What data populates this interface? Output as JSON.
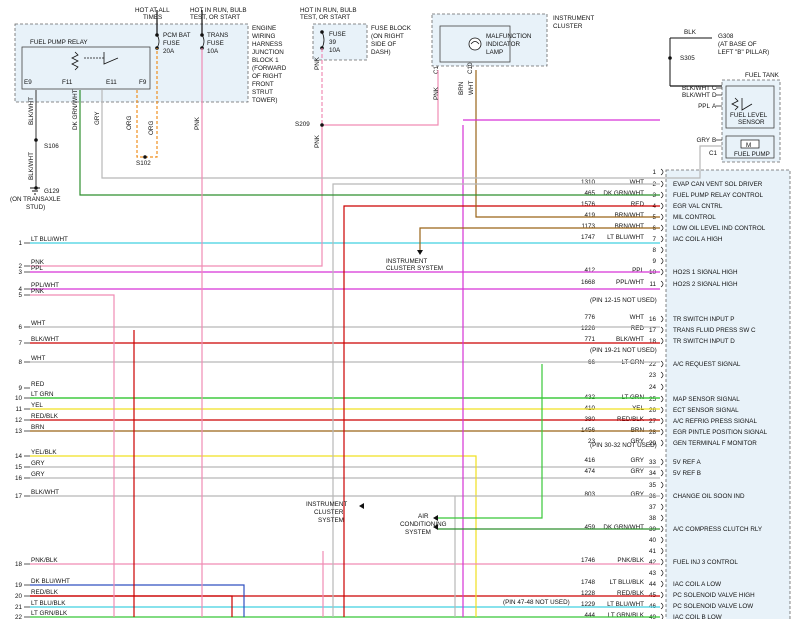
{
  "top_labels": {
    "hot_all": "HOT AT ALL\nTIMES",
    "hot_run_bulb_start": "HOT IN RUN, BULB\nTEST, OR START",
    "hot_run_bulb_start2": "HOT IN RUN, BULB\nTEST, OR START",
    "engine_wiring": "ENGINE\nWIRING\nHARNESS\nJUNCTION\nBLOCK 1\n(FORWARD\nOF RIGHT\nFRONT\nSTRUT\nTOWER)",
    "fuse_block": "FUSE BLOCK\n(ON RIGHT\nSIDE OF\nDASH)",
    "instrument_cluster": "INSTRUMENT\nCLUSTER",
    "g308_note": "(AT BASE OF\nLEFT \"B\" PILLAR)",
    "fuel_tank": "FUEL TANK"
  },
  "components": {
    "fuel_pump_relay": "FUEL PUMP RELAY",
    "pcm_bat_fuse": "PCM BAT\nFUSE\n20A",
    "trans_fuse": "TRANS\nFUSE\n10A",
    "fuse_39": "FUSE\n39\n10A",
    "mil_lamp": "MALFUNCTION\nINDICATOR\nLAMP",
    "fuel_level_sensor": "FUEL LEVEL\nSENSOR",
    "fuel_pump": "FUEL PUMP",
    "g308": "G308",
    "g129": "G129",
    "g129_note": "(ON TRANSAXLE\nSTUD)"
  },
  "pins": {
    "e9": "E9",
    "f11": "F11",
    "e11": "E11",
    "f9": "F9",
    "c1a": "C1",
    "c1b": "C1",
    "c10": "C10",
    "c1_tank": "C1"
  },
  "splices": {
    "s106": "S106",
    "s102": "S102",
    "s209": "S209",
    "s305": "S305"
  },
  "relay_wires": {
    "blk_wht": "BLK/WHT",
    "dk_grn_wht": "DK GRN/WHT",
    "gry": "GRY",
    "org": "ORG",
    "org2": "ORG",
    "pnk": "PNK",
    "blk_wht2": "BLK/WHT",
    "pnk2": "PNK",
    "pnk3": "PNK",
    "pnk4": "PNK",
    "brn": "BRN",
    "wht": "WHT",
    "blk": "BLK"
  },
  "tank_wires": [
    {
      "color": "BLK/WHT",
      "pin": "C"
    },
    {
      "color": "BLK/WHT",
      "pin": "D"
    },
    {
      "color": "PPL",
      "pin": "A"
    },
    {
      "color": "GRY",
      "pin": "B"
    }
  ],
  "left_connector": [
    {
      "num": "1",
      "color": "LT BLU/WHT"
    },
    {
      "num": "2",
      "color": "PNK"
    },
    {
      "num": "3",
      "color": "PPL"
    },
    {
      "num": "4",
      "color": "PPL/WHT"
    },
    {
      "num": "5",
      "color": "PNK"
    },
    {
      "num": "6",
      "color": "WHT"
    },
    {
      "num": "7",
      "color": "BLK/WHT"
    },
    {
      "num": "8",
      "color": "WHT"
    },
    {
      "num": "9",
      "color": "RED"
    },
    {
      "num": "10",
      "color": "LT GRN"
    },
    {
      "num": "11",
      "color": "YEL"
    },
    {
      "num": "12",
      "color": "RED/BLK"
    },
    {
      "num": "13",
      "color": "BRN"
    },
    {
      "num": "14",
      "color": "YEL/BLK"
    },
    {
      "num": "15",
      "color": "GRY"
    },
    {
      "num": "16",
      "color": "GRY"
    },
    {
      "num": "17",
      "color": "BLK/WHT"
    },
    {
      "num": "18",
      "color": "PNK/BLK"
    },
    {
      "num": "19",
      "color": "DK BLU/WHT"
    },
    {
      "num": "20",
      "color": "RED/BLK"
    },
    {
      "num": "21",
      "color": "LT BLU/BLK"
    },
    {
      "num": "22",
      "color": "LT GRN/BLK"
    }
  ],
  "pcm_pins": [
    {
      "pin": "1",
      "circuit": "",
      "wire": "",
      "func": ""
    },
    {
      "pin": "2",
      "circuit": "1310",
      "wire": "WHT",
      "func": "EVAP CAN VENT SOL DRIVER"
    },
    {
      "pin": "3",
      "circuit": "465",
      "wire": "DK GRN/WHT",
      "func": "FUEL PUMP RELAY CONTROL"
    },
    {
      "pin": "4",
      "circuit": "1576",
      "wire": "RED",
      "func": "EGR VAL CNTRL"
    },
    {
      "pin": "5",
      "circuit": "419",
      "wire": "BRN/WHT",
      "func": "MIL CONTROL"
    },
    {
      "pin": "6",
      "circuit": "1173",
      "wire": "BRN/WHT",
      "func": "LOW OIL LEVEL IND CONTROL"
    },
    {
      "pin": "7",
      "circuit": "1747",
      "wire": "LT BLU/WHT",
      "func": "IAC COIL A HIGH"
    },
    {
      "pin": "8",
      "circuit": "",
      "wire": "",
      "func": ""
    },
    {
      "pin": "9",
      "circuit": "",
      "wire": "",
      "func": ""
    },
    {
      "pin": "10",
      "circuit": "412",
      "wire": "PPL",
      "func": "HO2S 1 SIGNAL HIGH"
    },
    {
      "pin": "11",
      "circuit": "1668",
      "wire": "PPL/WHT",
      "func": "HO2S 2 SIGNAL HIGH"
    },
    {
      "pin": "16",
      "circuit": "776",
      "wire": "WHT",
      "func": "TR SWITCH INPUT P"
    },
    {
      "pin": "17",
      "circuit": "1226",
      "wire": "RED",
      "func": "TRANS FLUID PRESS SW C"
    },
    {
      "pin": "18",
      "circuit": "771",
      "wire": "BLK/WHT",
      "func": "TR SWITCH INPUT D"
    },
    {
      "pin": "22",
      "circuit": "66",
      "wire": "LT GRN",
      "func": "A/C REQUEST SIGNAL"
    },
    {
      "pin": "23",
      "circuit": "",
      "wire": "",
      "func": ""
    },
    {
      "pin": "24",
      "circuit": "",
      "wire": "",
      "func": ""
    },
    {
      "pin": "25",
      "circuit": "432",
      "wire": "LT GRN",
      "func": "MAP SENSOR SIGNAL"
    },
    {
      "pin": "26",
      "circuit": "410",
      "wire": "YEL",
      "func": "ECT SENSOR SIGNAL"
    },
    {
      "pin": "27",
      "circuit": "380",
      "wire": "RED/BLK",
      "func": "A/C REFRIG PRESS SIGNAL"
    },
    {
      "pin": "28",
      "circuit": "1456",
      "wire": "BRN",
      "func": "EGR PINTLE POSITION SIGNAL"
    },
    {
      "pin": "29",
      "circuit": "23",
      "wire": "GRY",
      "func": "GEN TERMINAL F MONITOR"
    },
    {
      "pin": "33",
      "circuit": "416",
      "wire": "GRY",
      "func": "5V REF A"
    },
    {
      "pin": "34",
      "circuit": "474",
      "wire": "GRY",
      "func": "5V REF B"
    },
    {
      "pin": "35",
      "circuit": "",
      "wire": "",
      "func": ""
    },
    {
      "pin": "36",
      "circuit": "803",
      "wire": "GRY",
      "func": "CHANGE OIL SOON IND"
    },
    {
      "pin": "37",
      "circuit": "",
      "wire": "",
      "func": ""
    },
    {
      "pin": "38",
      "circuit": "",
      "wire": "",
      "func": ""
    },
    {
      "pin": "39",
      "circuit": "459",
      "wire": "DK GRN/WHT",
      "func": "A/C COMPRESS CLUTCH RLY"
    },
    {
      "pin": "40",
      "circuit": "",
      "wire": "",
      "func": ""
    },
    {
      "pin": "41",
      "circuit": "",
      "wire": "",
      "func": ""
    },
    {
      "pin": "42",
      "circuit": "1746",
      "wire": "PNK/BLK",
      "func": "FUEL INJ 3 CONTROL"
    },
    {
      "pin": "43",
      "circuit": "",
      "wire": "",
      "func": ""
    },
    {
      "pin": "44",
      "circuit": "1748",
      "wire": "LT BLU/BLK",
      "func": "IAC COIL A LOW"
    },
    {
      "pin": "45",
      "circuit": "1228",
      "wire": "RED/BLK",
      "func": "PC SOLENOID VALVE HIGH"
    },
    {
      "pin": "46",
      "circuit": "1229",
      "wire": "LT BLU/WHT",
      "func": "PC SOLENOID VALVE LOW"
    },
    {
      "pin": "49",
      "circuit": "444",
      "wire": "LT GRN/BLK",
      "func": "IAC COIL B LOW"
    }
  ],
  "not_used": {
    "p12_15": "(PIN 12-15 NOT USED)",
    "p19_21": "(PIN 19-21 NOT USED)",
    "p30_32": "(PIN 30-32 NOT USED)",
    "p47_48": "(PIN 47-48 NOT USED)"
  },
  "destinations": {
    "ic_system1": "INSTRUMENT\nCLUSTER SYSTEM",
    "ic_system2": "INSTRUMENT\nCLUSTER\nSYSTEM",
    "ac_system": "AIR\nCONDITIONING\nSYSTEM"
  },
  "colors": {
    "pnk": "#f08cb4",
    "ppl": "#d633d6",
    "red": "#cc0000",
    "grn": "#2f8f2f",
    "ltblu": "#40d0e0",
    "ltgrn": "#38c838",
    "yel": "#f0e020",
    "brn": "#9a6418",
    "gry": "#b8b8b8",
    "org": "#f09020",
    "blu": "#3050c0",
    "blk": "#111111"
  }
}
